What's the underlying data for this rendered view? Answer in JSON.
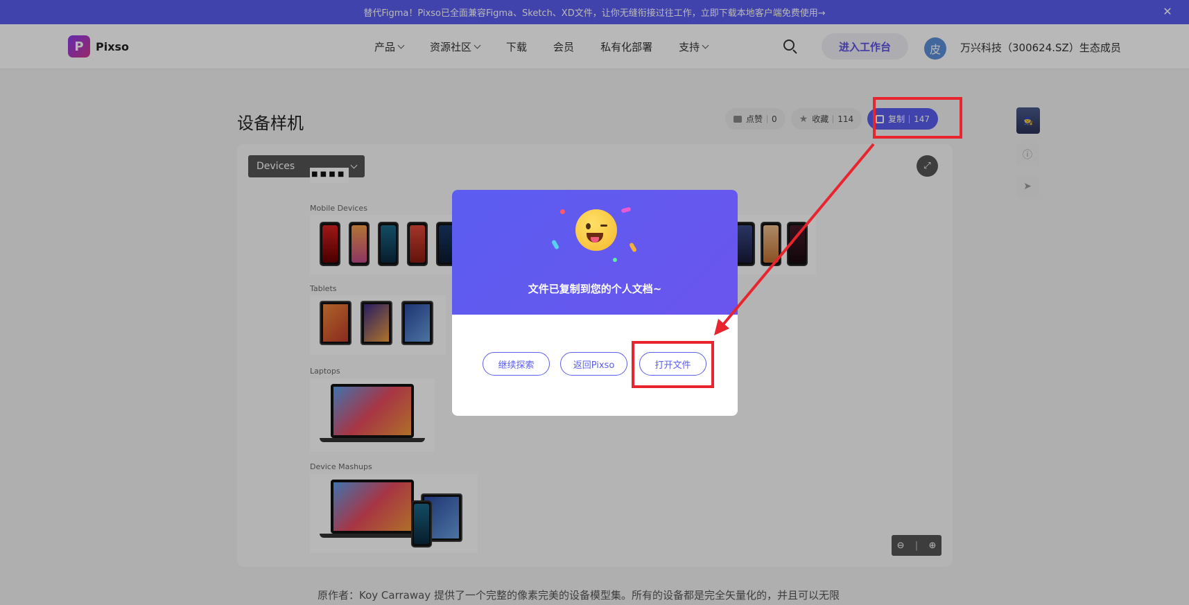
{
  "banner": {
    "text": "替代Figma！Pixso已全面兼容Figma、Sketch、XD文件，让你无缝衔接过往工作，立即下载本地客户端免费使用→",
    "close_glyph": "✕"
  },
  "header": {
    "logo_mark": "P",
    "logo_text": "Pixso",
    "nav": [
      {
        "label": "产品"
      },
      {
        "label": "资源社区"
      },
      {
        "label": "下载"
      },
      {
        "label": "会员"
      },
      {
        "label": "私有化部署"
      },
      {
        "label": "支持"
      }
    ],
    "workspace_button": "进入工作台",
    "avatar_initial": "皮",
    "partner_text": "万兴科技（300624.SZ）生态成员"
  },
  "page": {
    "title": "设备样机",
    "actions": {
      "like_label": "点赞",
      "like_count": "0",
      "fav_label": "收藏",
      "fav_count": "114",
      "copy_label": "复制",
      "copy_count": "147"
    },
    "author_text": "原作者：Koy Carraway 提供了一个完整的像素完美的设备模型集。所有的设备都是完全矢量化的，并且可以无限"
  },
  "canvas": {
    "dropdown_label": "Devices",
    "sections": {
      "mobile": "Mobile Devices",
      "tablets": "Tablets",
      "laptops": "Laptops",
      "mashups": "Device Mashups"
    }
  },
  "modal": {
    "message": "文件已复制到您的个人文档~",
    "buttons": {
      "continue": "继续探索",
      "back": "返回Pixso",
      "open": "打开文件"
    }
  },
  "colors": {
    "accent": "#5b5df0",
    "annotation": "#e8242e"
  }
}
